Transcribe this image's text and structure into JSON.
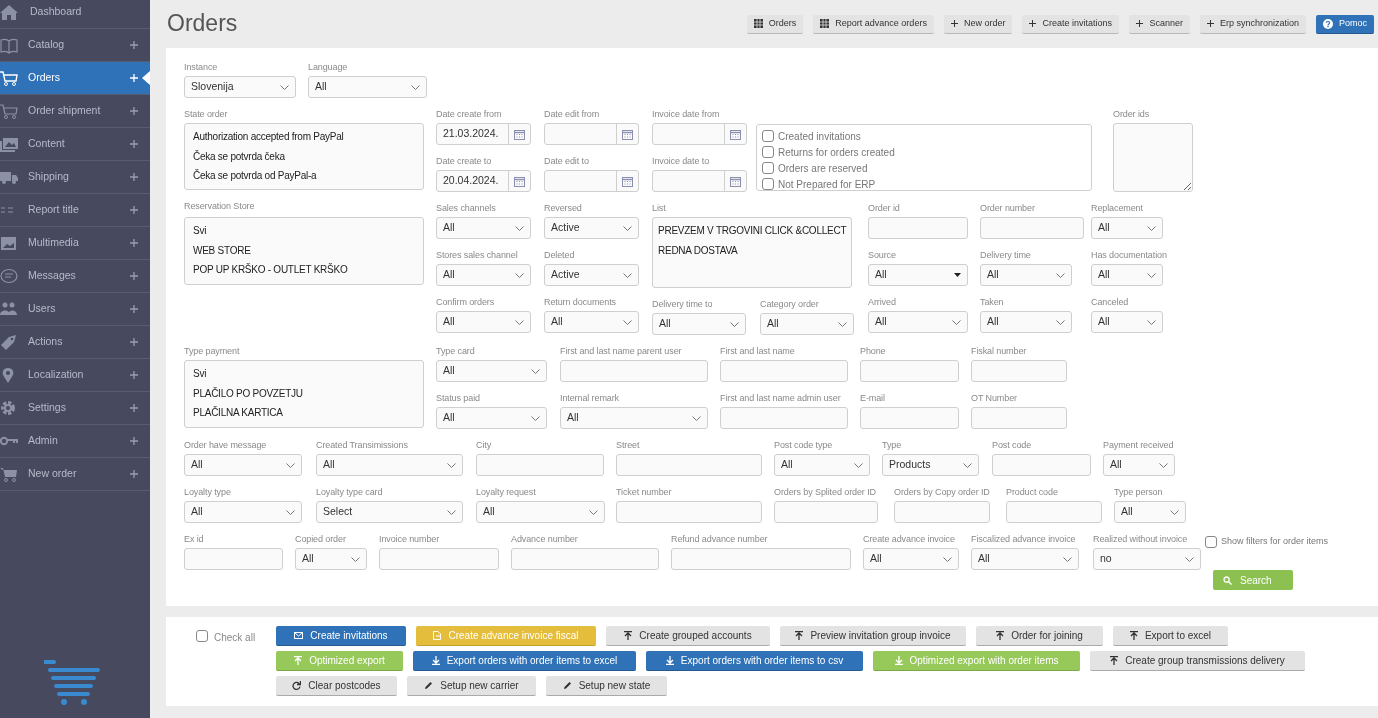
{
  "sidebar": {
    "items": [
      {
        "label": "Dashboard",
        "selected": false,
        "expandable": false
      },
      {
        "label": "Catalog",
        "selected": false,
        "expandable": true
      },
      {
        "label": "Orders",
        "selected": true,
        "expandable": true
      },
      {
        "label": "Order shipment",
        "selected": false,
        "expandable": true
      },
      {
        "label": "Content",
        "selected": false,
        "expandable": true
      },
      {
        "label": "Shipping",
        "selected": false,
        "expandable": true
      },
      {
        "label": "Report title",
        "selected": false,
        "expandable": true
      },
      {
        "label": "Multimedia",
        "selected": false,
        "expandable": true
      },
      {
        "label": "Messages",
        "selected": false,
        "expandable": true
      },
      {
        "label": "Users",
        "selected": false,
        "expandable": true
      },
      {
        "label": "Actions",
        "selected": false,
        "expandable": true
      },
      {
        "label": "Localization",
        "selected": false,
        "expandable": true
      },
      {
        "label": "Settings",
        "selected": false,
        "expandable": true
      },
      {
        "label": "Admin",
        "selected": false,
        "expandable": true
      },
      {
        "label": "New order",
        "selected": false,
        "expandable": true
      }
    ]
  },
  "header": {
    "title": "Orders",
    "buttons": [
      {
        "label": "Orders",
        "kind": "default"
      },
      {
        "label": "Report advance orders",
        "kind": "default"
      },
      {
        "label": "New order",
        "kind": "default"
      },
      {
        "label": "Create invitations",
        "kind": "default"
      },
      {
        "label": "Scanner",
        "kind": "default"
      },
      {
        "label": "Erp synchronization",
        "kind": "default"
      },
      {
        "label": "Pomoc",
        "kind": "primary"
      }
    ]
  },
  "filters": {
    "row_1": [
      {
        "kind": "select",
        "label": "Instance",
        "value": "Slovenija"
      },
      {
        "kind": "select",
        "label": "Language",
        "value": "All"
      }
    ],
    "block_2": {
      "lists": [
        {
          "kind": "listbox",
          "label": "State order",
          "options": [
            "Authorization accepted from PayPal",
            "Čeka se potvrda čeka",
            "Čeka se potvrda od PayPal-a"
          ]
        },
        {
          "kind": "listbox",
          "label": "Reservation Store",
          "options": [
            "Svi",
            "WEB STORE",
            "POP UP KRŠKO - OUTLET KRŠKO"
          ]
        }
      ],
      "dates": [
        [
          {
            "kind": "date",
            "label": "Date create from",
            "value": "21.03.2024."
          },
          {
            "kind": "date",
            "label": "Date create to",
            "value": "20.04.2024."
          }
        ],
        [
          {
            "kind": "date",
            "label": "Date edit from"
          },
          {
            "kind": "date",
            "label": "Date edit to"
          }
        ],
        [
          {
            "kind": "date",
            "label": "Invoice date from"
          },
          {
            "kind": "date",
            "label": "Invoice date to"
          }
        ]
      ],
      "flags": [
        {
          "label": "Created invitations",
          "checked": false
        },
        {
          "label": "Returns for orders created",
          "checked": false
        },
        {
          "label": "Orders are reserved",
          "checked": false
        },
        {
          "label": "Not Prepared for ERP",
          "checked": false
        }
      ],
      "order_ids": {
        "kind": "textarea",
        "label": "Order ids"
      },
      "columns": [
        [
          {
            "kind": "select",
            "label": "Sales channels",
            "value": "All"
          },
          {
            "kind": "select",
            "label": "Stores sales channel",
            "value": "All"
          },
          {
            "kind": "select",
            "label": "Confirm orders",
            "value": "All"
          }
        ],
        [
          {
            "kind": "select",
            "label": "Reversed",
            "value": "Active"
          },
          {
            "kind": "select",
            "label": "Deleted",
            "value": "Active"
          },
          {
            "kind": "select",
            "label": "Return documents",
            "value": "All"
          }
        ],
        [
          {
            "kind": "listbox",
            "label": "List",
            "options": [
              "PREVZEM V TRGOVINI CLICK &COLLECT",
              "REDNA DOSTAVA"
            ]
          },
          {
            "kind": "select",
            "label": "Delivery time to",
            "value": "All"
          },
          {
            "kind": "select",
            "label": "Category order",
            "value": "All"
          }
        ],
        [
          {
            "kind": "text",
            "label": "Order id"
          },
          {
            "kind": "dropdown",
            "label": "Source",
            "value": "All"
          },
          {
            "kind": "select",
            "label": "Arrived",
            "value": "All"
          }
        ],
        [
          {
            "kind": "text",
            "label": "Order number"
          },
          {
            "kind": "select",
            "label": "Delivery time",
            "value": "All"
          },
          {
            "kind": "select",
            "label": "Taken",
            "value": "All"
          }
        ],
        [
          {
            "kind": "select",
            "label": "Replacement",
            "value": "All"
          },
          {
            "kind": "select",
            "label": "Has documentation",
            "value": "All"
          },
          {
            "kind": "select",
            "label": "Canceled",
            "value": "All"
          }
        ]
      ]
    },
    "block_3": {
      "list": {
        "kind": "listbox",
        "label": "Type payment",
        "options": [
          "Svi",
          "PLAČILO PO POVZETJU",
          "PLAČILNA KARTICA"
        ]
      },
      "columns": [
        [
          {
            "kind": "select",
            "label": "Type card",
            "value": "All"
          },
          {
            "kind": "select",
            "label": "Status paid",
            "value": "All"
          }
        ],
        [
          {
            "kind": "text",
            "label": "First and last name parent user"
          },
          {
            "kind": "select",
            "label": "Internal remark",
            "value": "All"
          }
        ],
        [
          {
            "kind": "text",
            "label": "First and last name"
          },
          {
            "kind": "text",
            "label": "First and last name admin user"
          }
        ],
        [
          {
            "kind": "text",
            "label": "Phone"
          },
          {
            "kind": "text",
            "label": "E-mail"
          }
        ],
        [
          {
            "kind": "text",
            "label": "Fiskal number"
          },
          {
            "kind": "text",
            "label": "OT Number"
          }
        ]
      ]
    },
    "row_4": [
      {
        "kind": "select",
        "label": "Order have message",
        "value": "All"
      },
      {
        "kind": "select",
        "label": "Created Transimissions",
        "value": "All"
      },
      {
        "kind": "text",
        "label": "City"
      },
      {
        "kind": "text",
        "label": "Street"
      },
      {
        "kind": "select",
        "label": "Post code type",
        "value": "All"
      },
      {
        "kind": "select",
        "label": "Type",
        "value": "Products"
      },
      {
        "kind": "text",
        "label": "Post code"
      },
      {
        "kind": "select",
        "label": "Payment received",
        "value": "All"
      }
    ],
    "row_5": [
      {
        "kind": "select",
        "label": "Loyalty type",
        "value": "All"
      },
      {
        "kind": "select",
        "label": "Loyalty type card",
        "value": "Select"
      },
      {
        "kind": "select",
        "label": "Loyalty request",
        "value": "All"
      },
      {
        "kind": "text",
        "label": "Ticket number"
      },
      {
        "kind": "text",
        "label": "Orders by Splited order ID"
      },
      {
        "kind": "text",
        "label": "Orders by Copy order ID"
      },
      {
        "kind": "text",
        "label": "Product code"
      },
      {
        "kind": "select",
        "label": "Type person",
        "value": "All"
      }
    ],
    "row_6": [
      {
        "kind": "text",
        "label": "Ex id"
      },
      {
        "kind": "select",
        "label": "Copied order",
        "value": "All"
      },
      {
        "kind": "text",
        "label": "Invoice number"
      },
      {
        "kind": "text",
        "label": "Advance number"
      },
      {
        "kind": "text",
        "label": "Refund advance number"
      },
      {
        "kind": "select",
        "label": "Create advance invoice",
        "value": "All"
      },
      {
        "kind": "select",
        "label": "Fiscalized advance invoice",
        "value": "All"
      },
      {
        "kind": "select",
        "label": "Realized without invoice",
        "value": "no"
      }
    ],
    "show_filters": {
      "label": "Show filters for order items",
      "checked": false
    },
    "search": "Search"
  },
  "actions": {
    "check_all": {
      "label": "Check all",
      "checked": false
    },
    "buttons": [
      {
        "label": "Create invitations",
        "kind": "primary"
      },
      {
        "label": "Create advance invoice fiscal",
        "kind": "warning"
      },
      {
        "label": "Create grouped accounts",
        "kind": "default"
      },
      {
        "label": "Preview invitation group invoice",
        "kind": "default"
      },
      {
        "label": "Order for joining",
        "kind": "default"
      },
      {
        "label": "Export to excel",
        "kind": "default"
      },
      {
        "label": "Optimized export",
        "kind": "success"
      },
      {
        "label": "Export orders with order items to excel",
        "kind": "primary"
      },
      {
        "label": "Export orders with order items to csv",
        "kind": "primary"
      },
      {
        "label": "Optimized export with order items",
        "kind": "success"
      },
      {
        "label": "Create group transmissions delivery",
        "kind": "default"
      },
      {
        "label": "Clear postcodes",
        "kind": "default"
      },
      {
        "label": "Setup new carrier",
        "kind": "default"
      },
      {
        "label": "Setup new state",
        "kind": "default"
      }
    ]
  }
}
